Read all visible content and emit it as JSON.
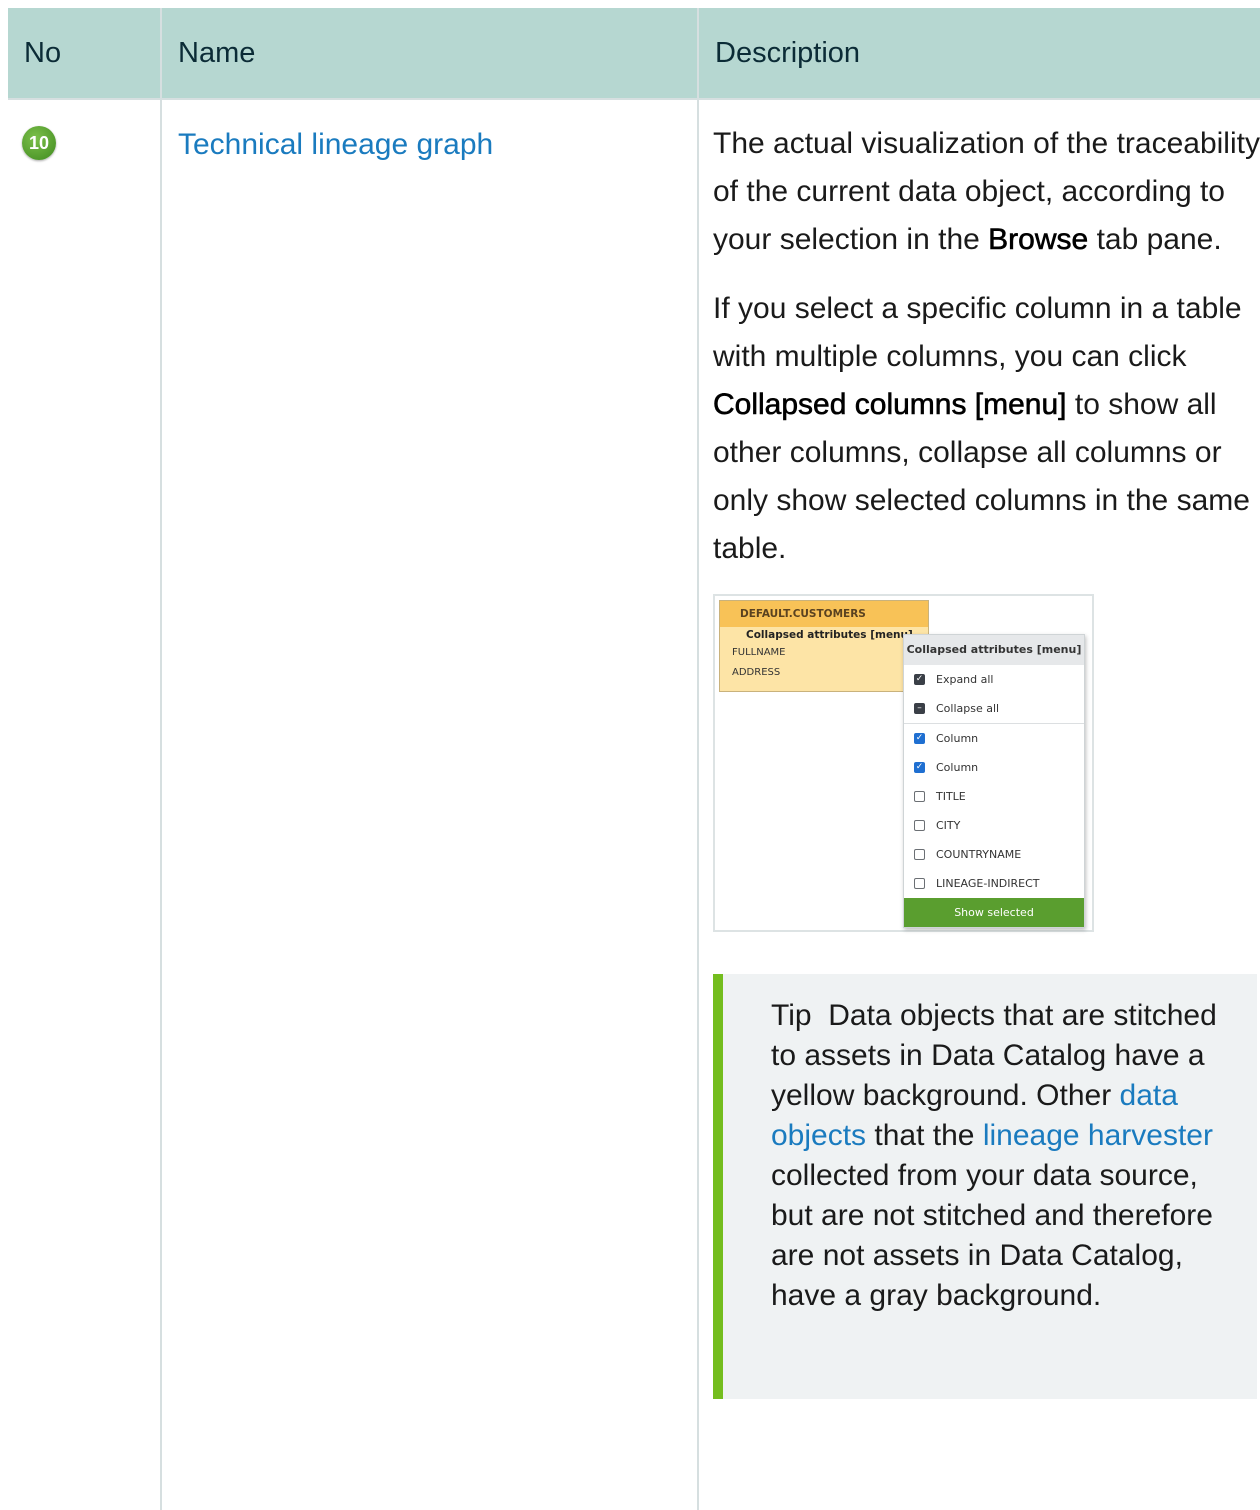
{
  "table": {
    "headers": {
      "no": "No",
      "name": "Name",
      "description": "Description"
    },
    "row": {
      "badge": "10",
      "name_link": "Technical lineage graph",
      "p1": {
        "a": "The actual visualization of the traceability of the current data object, according to your selection in the",
        "bold": "Browse",
        "b": "tab pane."
      },
      "p2": {
        "a": "If you select a specific column in a table with multiple columns, you can click",
        "bold": "Collapsed columns [menu]",
        "b": "to show all other columns, collapse all columns or only show selected columns in the same table."
      }
    }
  },
  "screenshot": {
    "table_name": "DEFAULT.CUSTOMERS",
    "collapsed_label": "Collapsed attributes [menu]",
    "rows": [
      "FULLNAME",
      "ADDRESS"
    ],
    "menu": {
      "title": "Collapsed attributes [menu]",
      "expand_all": "Expand all",
      "collapse_all": "Collapse all",
      "columns": [
        {
          "label": "Column",
          "checked": true
        },
        {
          "label": "Column",
          "checked": true
        },
        {
          "label": "TITLE",
          "checked": false
        },
        {
          "label": "CITY",
          "checked": false
        },
        {
          "label": "COUNTRYNAME",
          "checked": false
        },
        {
          "label": "LINEAGE-INDIRECT",
          "checked": false
        }
      ],
      "button": "Show selected"
    }
  },
  "tip": {
    "label": "Tip",
    "t1": "Data objects that are stitched to assets in Data Catalog have a yellow background. Other",
    "link1": "data objects",
    "t2": "that the",
    "link2": "lineage harvester",
    "t3": "collected from your data source, but are not stitched and therefore are not assets in Data Catalog, have a gray background."
  },
  "colors": {
    "header_bg": "#b6d7d1",
    "link": "#1a7bbf",
    "tip_bar": "#74bd1e",
    "tip_bg": "#eff2f3",
    "button": "#5a9e2f",
    "table_header": "#f8c257",
    "table_body": "#fde4a6"
  }
}
